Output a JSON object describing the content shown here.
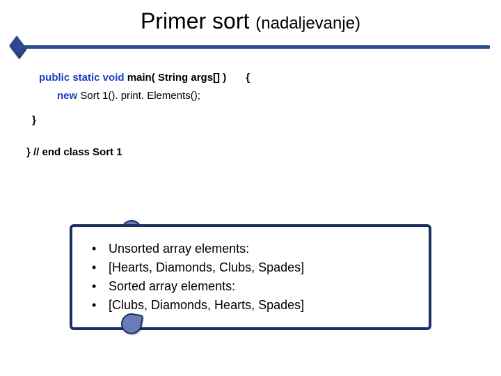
{
  "title": {
    "main": "Primer sort",
    "sub": "(nadaljevanje)"
  },
  "code": {
    "line1_kw": "public static void",
    "line1_rest": " main( String args[] )",
    "line1_brace": "{",
    "line2_kw": "new",
    "line2_rest": " Sort 1(). print. Elements();",
    "line3": "}",
    "line4": "} // end class Sort 1"
  },
  "output": {
    "bullet": "•",
    "lines": [
      "Unsorted array elements:",
      "[Hearts, Diamonds, Clubs, Spades]",
      "Sorted array elements:",
      "[Clubs, Diamonds, Hearts, Spades]"
    ]
  }
}
